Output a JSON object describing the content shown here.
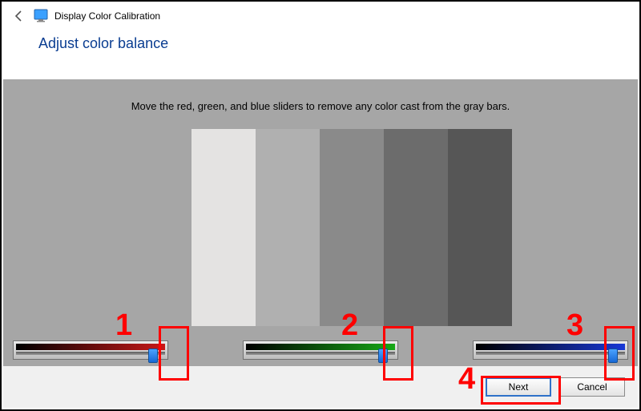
{
  "window": {
    "title": "Display Color Calibration",
    "heading": "Adjust color balance"
  },
  "instruction": "Move the red, green, and blue sliders to remove any color cast from the gray bars.",
  "sliders": {
    "red": {
      "value_percent": 90
    },
    "green": {
      "value_percent": 90
    },
    "blue": {
      "value_percent": 90
    }
  },
  "buttons": {
    "next": "Next",
    "cancel": "Cancel"
  },
  "annotations": {
    "n1": "1",
    "n2": "2",
    "n3": "3",
    "n4": "4"
  }
}
